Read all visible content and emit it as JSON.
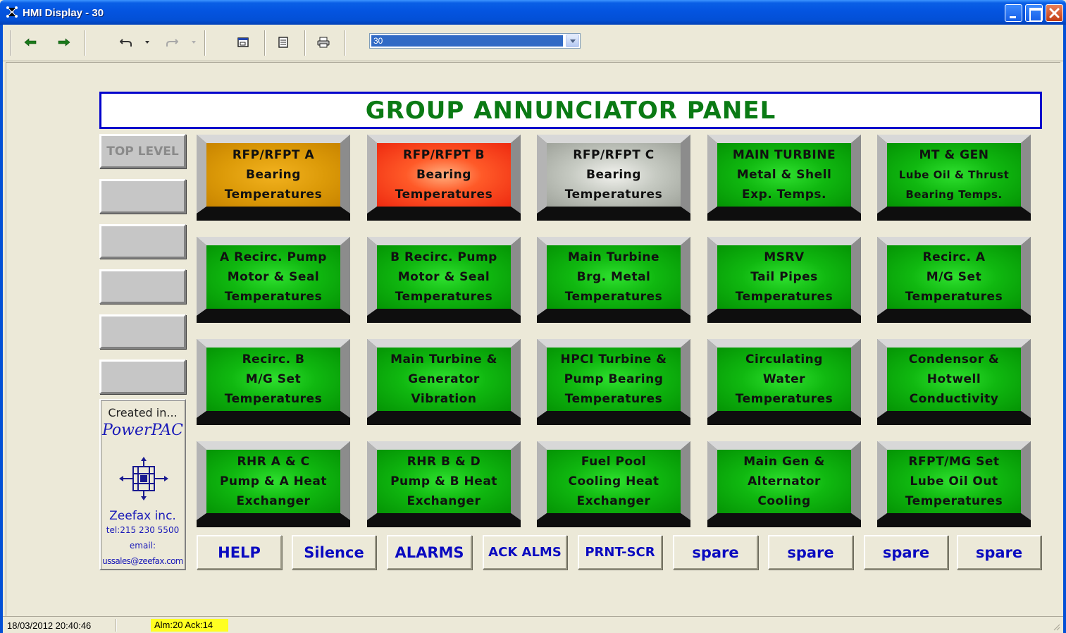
{
  "window": {
    "title": "HMI Display - 30",
    "icon": "app-network-icon"
  },
  "toolbar": {
    "buttons": [
      "back-arrow-icon",
      "forward-arrow-icon",
      "undo-icon",
      "redo-icon",
      "window-icon",
      "page-icon",
      "print-icon"
    ],
    "display_select_value": "30"
  },
  "panel": {
    "title": "GROUP ANNUNCIATOR PANEL"
  },
  "nav": {
    "items": [
      {
        "label": "TOP LEVEL"
      },
      {
        "label": ""
      },
      {
        "label": ""
      },
      {
        "label": ""
      },
      {
        "label": ""
      },
      {
        "label": ""
      }
    ]
  },
  "credits": {
    "created": "Created in...",
    "product": "PowerPAC",
    "logo_icon": "zeefax-logo-icon",
    "company": "Zeefax inc.",
    "tel": "tel:215 230 5500",
    "email_label": "email:",
    "email": "ussales@zeefax.com"
  },
  "colors": {
    "alarm_amber": "#dc9a08",
    "alarm_red": "#ff5a28",
    "alarm_grey": "#c6cac2",
    "normal_green": "#10b810",
    "header_text": "#0a7a14",
    "header_border": "#0000cc",
    "button_text": "#0a0ac0",
    "status_highlight": "#ffff22"
  },
  "annunciators": [
    {
      "state": "amber",
      "lines": [
        "RFP/RFPT A",
        "Bearing",
        "Temperatures"
      ]
    },
    {
      "state": "red",
      "lines": [
        "RFP/RFPT B",
        "Bearing",
        "Temperatures"
      ]
    },
    {
      "state": "grey",
      "lines": [
        "RFP/RFPT C",
        "Bearing",
        "Temperatures"
      ]
    },
    {
      "state": "green",
      "lines": [
        "MAIN TURBINE",
        "Metal & Shell",
        "Exp. Temps."
      ]
    },
    {
      "state": "green",
      "lines": [
        "MT & GEN",
        "Lube Oil & Thrust",
        "Bearing Temps."
      ]
    },
    {
      "state": "green",
      "lines": [
        "A Recirc. Pump",
        "Motor & Seal",
        "Temperatures"
      ]
    },
    {
      "state": "green",
      "lines": [
        "B Recirc. Pump",
        "Motor & Seal",
        "Temperatures"
      ]
    },
    {
      "state": "green",
      "lines": [
        "Main Turbine",
        "Brg. Metal",
        "Temperatures"
      ]
    },
    {
      "state": "green",
      "lines": [
        "MSRV",
        "Tail Pipes",
        "Temperatures"
      ]
    },
    {
      "state": "green",
      "lines": [
        "Recirc. A",
        "M/G Set",
        "Temperatures"
      ]
    },
    {
      "state": "green",
      "lines": [
        "Recirc. B",
        "M/G Set",
        "Temperatures"
      ]
    },
    {
      "state": "green",
      "lines": [
        "Main Turbine &",
        "Generator",
        "Vibration"
      ]
    },
    {
      "state": "green",
      "lines": [
        "HPCI Turbine &",
        "Pump Bearing",
        "Temperatures"
      ]
    },
    {
      "state": "green",
      "lines": [
        "Circulating",
        "Water",
        "Temperatures"
      ]
    },
    {
      "state": "green",
      "lines": [
        "Condensor &",
        "Hotwell",
        "Conductivity"
      ]
    },
    {
      "state": "green",
      "lines": [
        "RHR A & C",
        "Pump & A Heat",
        "Exchanger"
      ]
    },
    {
      "state": "green",
      "lines": [
        "RHR B & D",
        "Pump & B Heat",
        "Exchanger"
      ]
    },
    {
      "state": "green",
      "lines": [
        "Fuel Pool",
        "Cooling Heat",
        "Exchanger"
      ]
    },
    {
      "state": "green",
      "lines": [
        "Main Gen &",
        "Alternator",
        "Cooling"
      ]
    },
    {
      "state": "green",
      "lines": [
        "RFPT/MG Set",
        "Lube Oil Out",
        "Temperatures"
      ]
    }
  ],
  "commands": [
    {
      "label": "HELP"
    },
    {
      "label": "Silence"
    },
    {
      "label": "ALARMS"
    },
    {
      "label": "ACK ALMS"
    },
    {
      "label": "PRNT-SCR"
    },
    {
      "label": "spare"
    },
    {
      "label": "spare"
    },
    {
      "label": "spare"
    },
    {
      "label": "spare"
    }
  ],
  "status": {
    "datetime": "18/03/2012 20:40:46",
    "alarm_summary": "Alm:20 Ack:14"
  }
}
